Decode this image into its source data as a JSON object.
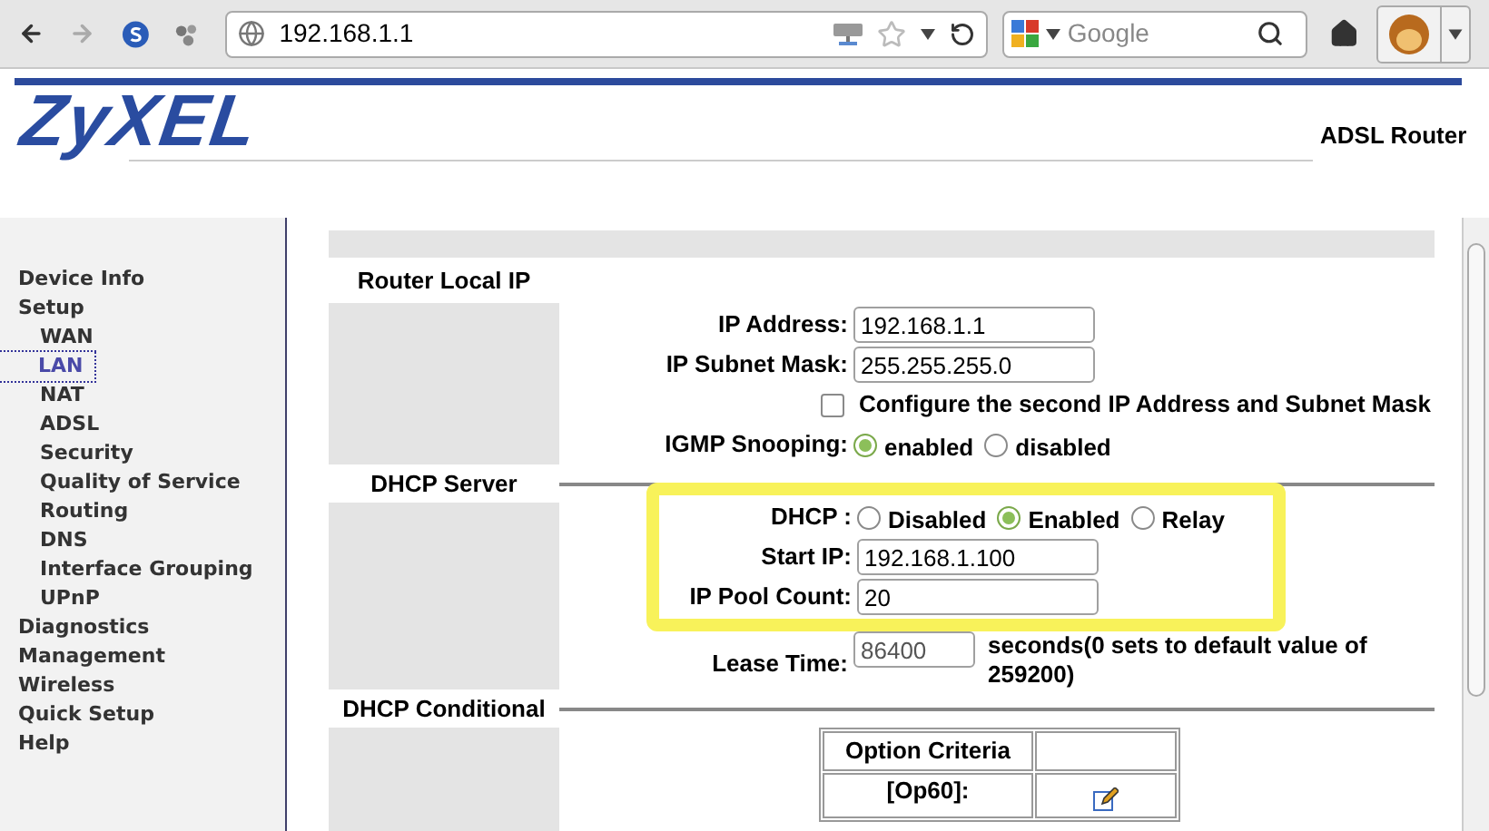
{
  "browser": {
    "address": "192.168.1.1",
    "search_placeholder": "Google"
  },
  "header": {
    "logo": "ZyXEL",
    "product": "ADSL Router"
  },
  "sidebar": {
    "items": [
      {
        "label": "Device Info",
        "selected": false
      },
      {
        "label": "Setup",
        "selected": false,
        "children": [
          {
            "label": "WAN",
            "selected": false
          },
          {
            "label": "LAN",
            "selected": true
          },
          {
            "label": "NAT",
            "selected": false
          },
          {
            "label": "ADSL",
            "selected": false
          },
          {
            "label": "Security",
            "selected": false
          },
          {
            "label": "Quality of Service",
            "selected": false
          },
          {
            "label": "Routing",
            "selected": false
          },
          {
            "label": "DNS",
            "selected": false
          },
          {
            "label": "Interface Grouping",
            "selected": false
          },
          {
            "label": "UPnP",
            "selected": false
          }
        ]
      },
      {
        "label": "Diagnostics",
        "selected": false
      },
      {
        "label": "Management",
        "selected": false
      },
      {
        "label": "Wireless",
        "selected": false
      },
      {
        "label": "Quick Setup",
        "selected": false
      },
      {
        "label": "Help",
        "selected": false
      }
    ]
  },
  "sections": [
    {
      "title": "Router Local IP",
      "rows": [
        {
          "kind": "input",
          "label": "IP Address:",
          "value": "192.168.1.1"
        },
        {
          "kind": "input",
          "label": "IP Subnet Mask:",
          "value": "255.255.255.0"
        },
        {
          "kind": "checkbox",
          "checked": false,
          "text": "Configure the second IP Address and Subnet Mask"
        },
        {
          "kind": "radio",
          "label": "IGMP Snooping:",
          "options": [
            {
              "text": "enabled",
              "selected": true
            },
            {
              "text": "disabled",
              "selected": false
            }
          ]
        }
      ]
    },
    {
      "title": "DHCP Server",
      "highlighted_rows": [
        {
          "kind": "radio",
          "label": "DHCP :",
          "options": [
            {
              "text": "Disabled",
              "selected": false
            },
            {
              "text": "Enabled",
              "selected": true
            },
            {
              "text": "Relay",
              "selected": false
            }
          ]
        },
        {
          "kind": "input",
          "label": "Start IP:",
          "value": "192.168.1.100"
        },
        {
          "kind": "input",
          "label": "IP Pool Count:",
          "value": "20"
        }
      ],
      "rows": [
        {
          "kind": "short_input",
          "label": "Lease Time:",
          "value": "86400",
          "note": "seconds(0 sets to default value of 259200)"
        }
      ]
    },
    {
      "title": "DHCP Conditional",
      "table": {
        "columns": [
          "Option Criteria"
        ],
        "rows": [
          {
            "criteria": "[Op60]:"
          }
        ]
      }
    }
  ]
}
